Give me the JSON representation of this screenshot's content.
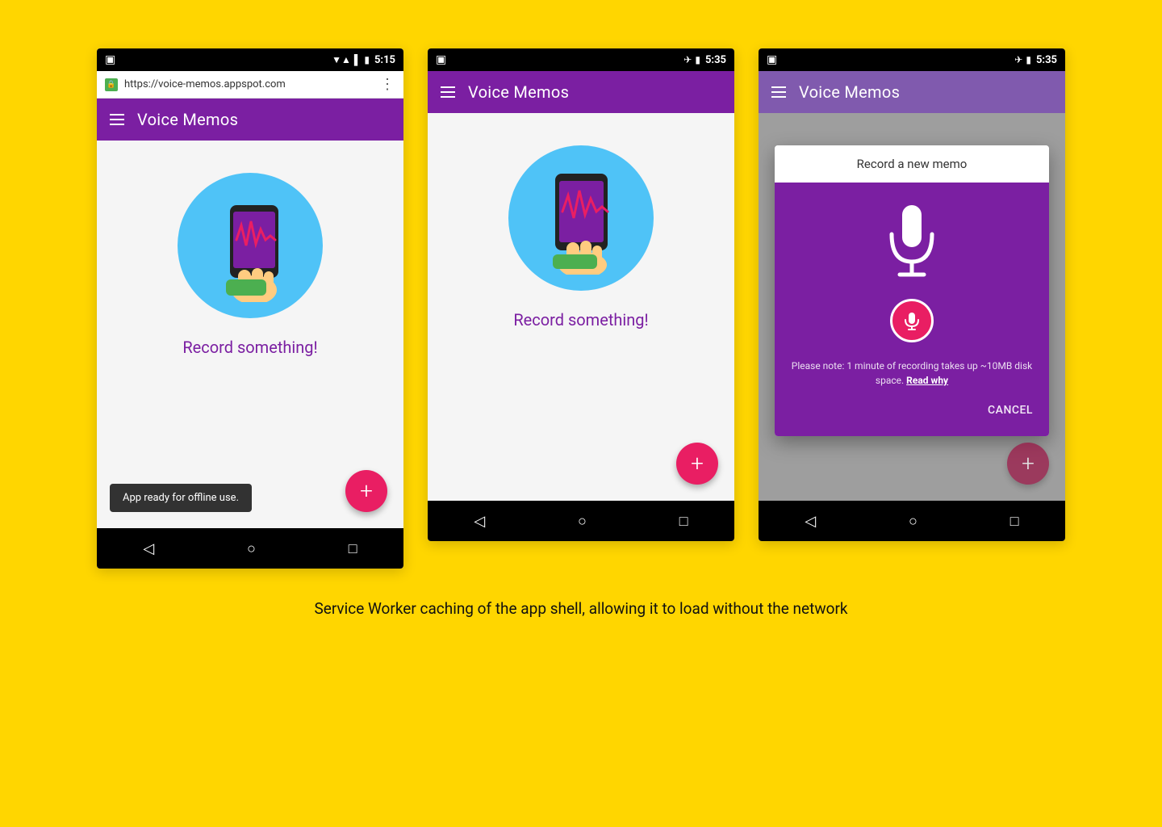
{
  "page": {
    "background_color": "#FFD600",
    "caption": "Service Worker caching of the app shell, allowing it to load without the network"
  },
  "phone1": {
    "status_bar": {
      "left_icon": "☰",
      "signal": "▼",
      "wifi": "▲",
      "battery": "🔋",
      "time": "5:15"
    },
    "url": "https://voice-memos.appspot.com",
    "app_title": "Voice Memos",
    "record_label": "Record something!",
    "snackbar": "App ready for offline use.",
    "fab_label": "+"
  },
  "phone2": {
    "status_bar": {
      "time": "5:35"
    },
    "app_title": "Voice Memos",
    "record_label": "Record something!",
    "fab_label": "+"
  },
  "phone3": {
    "status_bar": {
      "time": "5:35"
    },
    "app_title": "Voice Memos",
    "dialog_title": "Record a new memo",
    "dialog_note": "Please note: 1 minute of recording takes up ~10MB disk space.",
    "read_why": "Read why",
    "cancel": "CANCEL",
    "fab_label": "+"
  },
  "nav": {
    "back": "◁",
    "home": "○",
    "recent": "□"
  }
}
